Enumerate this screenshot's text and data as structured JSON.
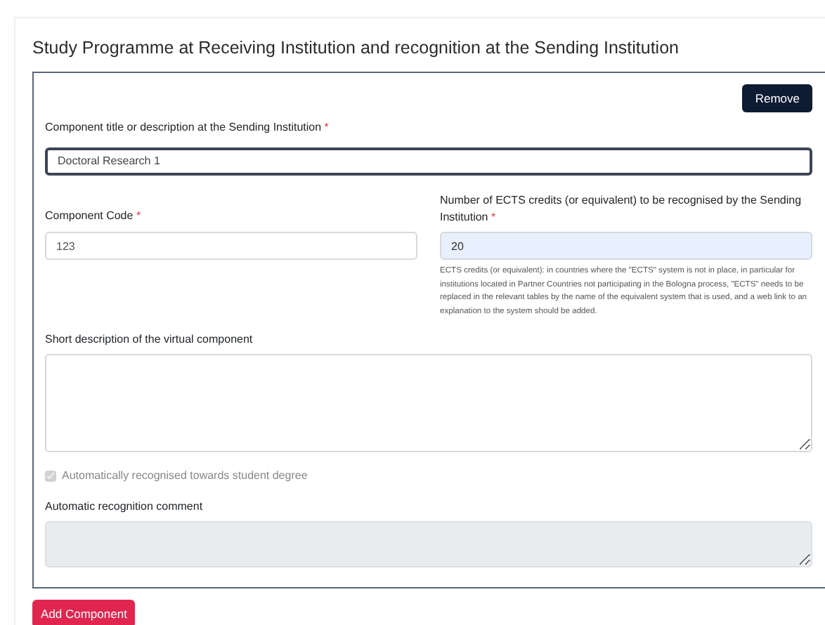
{
  "section": {
    "title": "Study Programme at Receiving Institution and recognition at the Sending Institution"
  },
  "component": {
    "remove_button": "Remove",
    "title_field": {
      "label": "Component title or description at the Sending Institution",
      "required_mark": "*",
      "value": "Doctoral Research 1",
      "focused": true
    },
    "code_field": {
      "label": "Component Code",
      "required_mark": "*",
      "value": "123"
    },
    "credits_field": {
      "label": "Number of ECTS credits (or equivalent) to be recognised by the Sending Institution",
      "required_mark": "*",
      "value": "20",
      "autofilled": true,
      "help": "ECTS credits (or equivalent): in countries where the \"ECTS\" system is not in place, in particular for institutions located in Partner Countries not participating in the Bologna process, \"ECTS\" needs to be replaced in the relevant tables by the name of the equivalent system that is used, and a web link to an explanation to the system should be added."
    },
    "description_field": {
      "label": "Short description of the virtual component"
    },
    "auto_recognised": {
      "label": "Automatically recognised towards student degree",
      "checked": true,
      "disabled": true
    },
    "comment_field": {
      "label": "Automatic recognition comment",
      "disabled": true
    }
  },
  "add_button": "Add Component"
}
